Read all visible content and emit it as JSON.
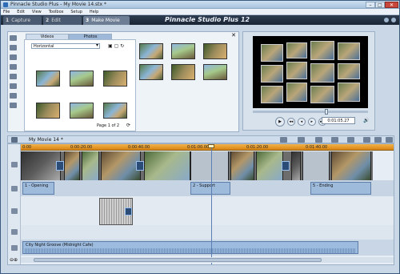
{
  "window": {
    "title": "Pinnacle Studio Plus - My Movie 14.stx *",
    "min": "–",
    "max": "□",
    "close": "✕"
  },
  "menu": [
    "File",
    "Edit",
    "View",
    "Toolbox",
    "Setup",
    "Help"
  ],
  "tabs": [
    {
      "num": "1",
      "label": "Capture"
    },
    {
      "num": "2",
      "label": "Edit"
    },
    {
      "num": "3",
      "label": "Make Movie"
    }
  ],
  "brand": "Pinnacle Studio Plus 12",
  "album": {
    "tabs": [
      "Videos",
      "Photos"
    ],
    "close": "✕",
    "folder": "Horizontal",
    "page_label": "Page 1 of 2"
  },
  "preview": {
    "timecode": "0:01:05.27",
    "play": "▶",
    "controls": [
      "◂◂",
      "◂",
      "▸",
      "▸▸",
      "⏺"
    ]
  },
  "timeline": {
    "movie_title": "My Movie 14 *",
    "ruler": [
      "0:00",
      "0:00:20.00",
      "0:00:40.00",
      "0:01:00.00",
      "0:01:20.00",
      "0:01:40.00"
    ],
    "title_clips": [
      "1 - Opening",
      "2 - Support",
      "5 - Ending"
    ],
    "music": "City Night Groove (Midnight Cafe)"
  },
  "colors": {
    "ruler": "#e59a2a",
    "accent": "#2c4c78",
    "panel": "#c9d7e6"
  }
}
